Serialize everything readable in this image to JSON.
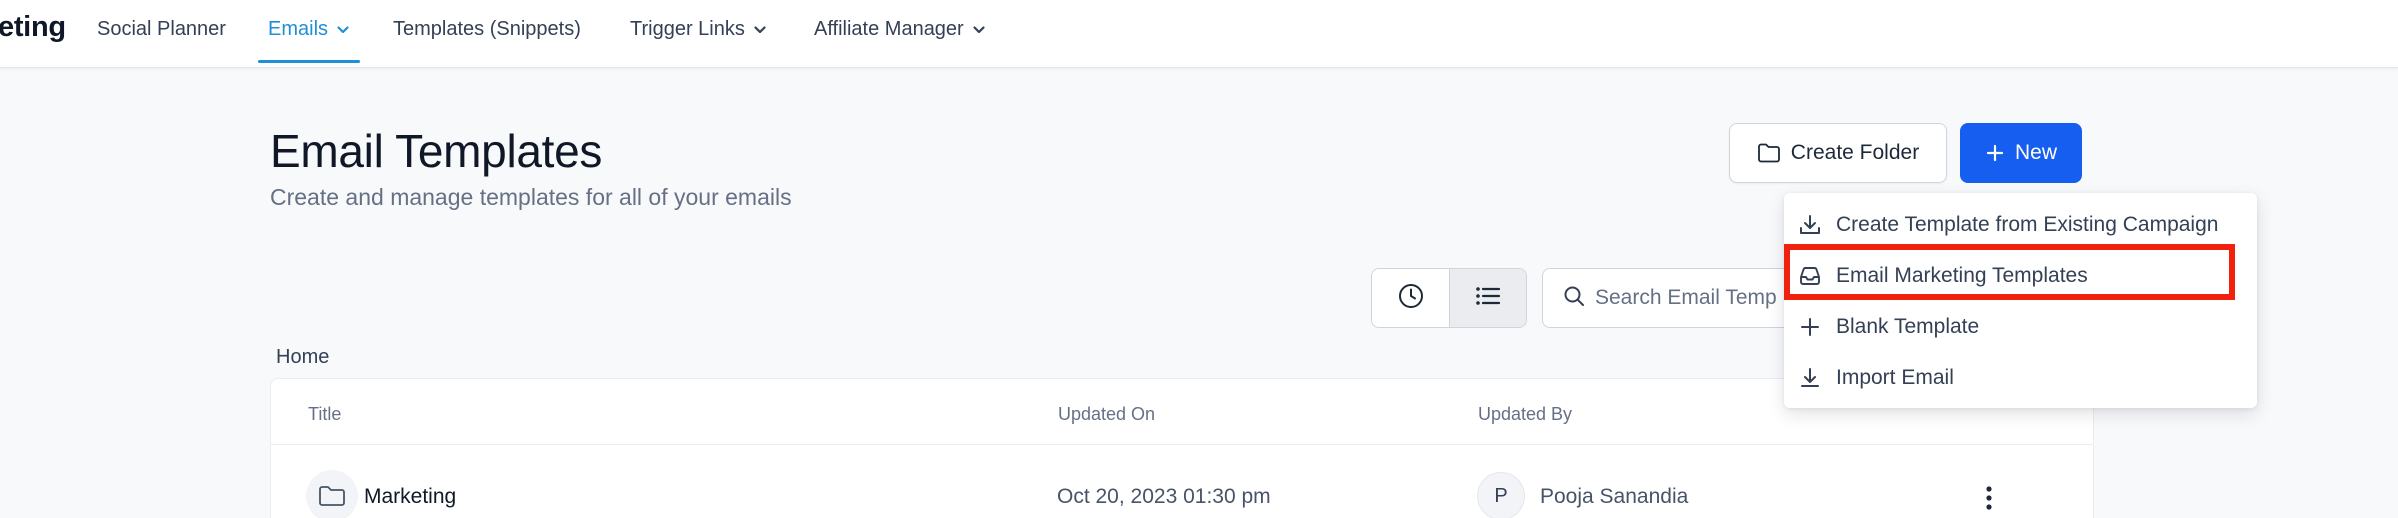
{
  "nav": {
    "brand": "eting",
    "items": [
      {
        "label": "Social Planner"
      },
      {
        "label": "Emails"
      },
      {
        "label": "Templates (Snippets)"
      },
      {
        "label": "Trigger Links"
      },
      {
        "label": "Affiliate Manager"
      }
    ]
  },
  "header": {
    "title": "Email Templates",
    "subtitle": "Create and manage templates for all of your emails",
    "create_folder_label": "Create Folder",
    "new_label": "New"
  },
  "toolbar": {
    "search_placeholder": "Search Email Temp"
  },
  "breadcrumb": "Home",
  "table": {
    "columns": [
      "Title",
      "Updated On",
      "Updated By"
    ],
    "rows": [
      {
        "title": "Marketing",
        "updated_on": "Oct 20, 2023 01:30 pm",
        "avatar_initial": "P",
        "updated_by": "Pooja Sanandia"
      }
    ]
  },
  "new_menu": {
    "items": [
      {
        "label": "Create Template from Existing Campaign",
        "icon": "download-icon"
      },
      {
        "label": "Email Marketing Templates",
        "icon": "inbox-icon"
      },
      {
        "label": "Blank Template",
        "icon": "plus-icon"
      },
      {
        "label": "Import Email",
        "icon": "import-icon"
      }
    ]
  },
  "colors": {
    "accent": "#1f8fd6",
    "primary_button": "#155eef",
    "highlight": "#f0220f"
  }
}
